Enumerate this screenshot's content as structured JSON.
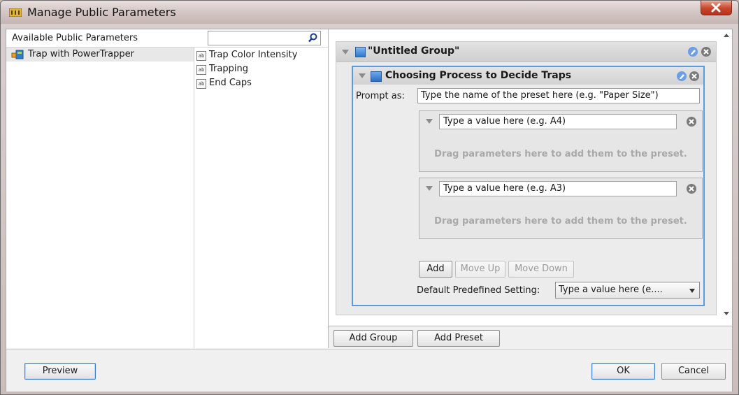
{
  "window": {
    "title": "Manage Public Parameters"
  },
  "available": {
    "label": "Available Public Parameters",
    "search_value": "",
    "workflows": [
      {
        "label": "Trap with PowerTrapper",
        "icon": "workflow-icon"
      }
    ],
    "fields": [
      {
        "label": "Trap Color Intensity",
        "icon": "text-field-icon"
      },
      {
        "label": "Trapping",
        "icon": "text-field-icon"
      },
      {
        "label": "End Caps",
        "icon": "text-field-icon"
      }
    ]
  },
  "group": {
    "title": "\"Untitled Group\"",
    "preset": {
      "title": "Choosing Process to Decide Traps",
      "prompt_label": "Prompt as:",
      "prompt_value": "Type the name of the preset here (e.g. \"Paper Size\")",
      "values": [
        {
          "value": "Type a value here (e.g. A4)",
          "drag_text": "Drag parameters here to add them to the preset."
        },
        {
          "value": "Type a value here (e.g. A3)",
          "drag_text": "Drag parameters here to add them to the preset."
        }
      ],
      "buttons": {
        "add": "Add",
        "move_up": "Move Up",
        "move_down": "Move Down"
      },
      "default_label": "Default Predefined Setting:",
      "default_value": "Type a value here (e...."
    }
  },
  "right_buttons": {
    "add_group": "Add Group",
    "add_preset": "Add Preset"
  },
  "footer": {
    "preview": "Preview",
    "ok": "OK",
    "cancel": "Cancel"
  },
  "colors": {
    "selection_border": "#5a9be0",
    "close_button": "#c7452a",
    "edit_icon": "#6d9ee8"
  }
}
